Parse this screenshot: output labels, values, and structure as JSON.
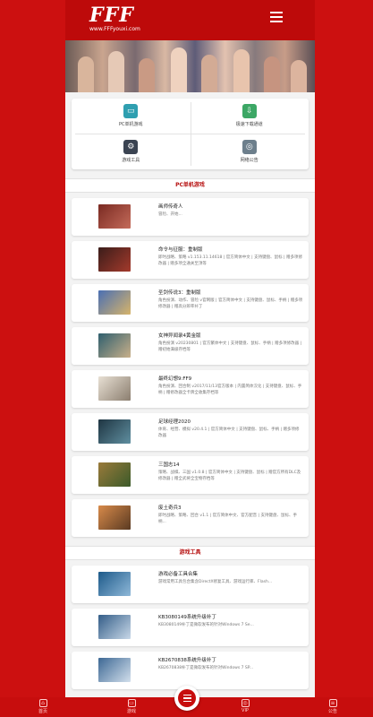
{
  "header": {
    "logo_mark": "FFF",
    "logo_sub": "www.FFFyouxi.com"
  },
  "quick_links": [
    {
      "label": "PC单机游戏",
      "icon": "monitor-icon",
      "color": "#2f9fb0"
    },
    {
      "label": "极速下载通道",
      "icon": "download-icon",
      "color": "#3ca765"
    },
    {
      "label": "游戏工具",
      "icon": "gear-icon",
      "color": "#3b4452"
    },
    {
      "label": "网络公告",
      "icon": "globe-icon",
      "color": "#6d7f8c"
    }
  ],
  "sections": {
    "pc_games": "PC单机游戏",
    "tools": "游戏工具"
  },
  "games": [
    {
      "title": "画师传奇人",
      "desc": "冒险、开始...",
      "thumb": "#7a2a22"
    },
    {
      "title": "命令与征服：重制版",
      "desc": "即时战略、策略 v1.153.11.14618 | 官方简体中文 | 支持键盘、鼠标 | 赠多项修改器 | 赠多项全通关至顶等",
      "thumb": "#3b1d1a"
    },
    {
      "title": "圣剑传说3：重制版",
      "desc": "角色扮演、动作、冒险 v官网版 | 官方简体中文 | 支持键盘、鼠标、手柄 | 赠多项修改器 | 赠高分辨率补丁",
      "thumb": "#4a6fb3"
    },
    {
      "title": "女神异闻录4黄金版",
      "desc": "角色扮演 v20230801 | 官方繁体中文 | 支持键盘、鼠标、手柄 | 赠多项修改器 | 赠初始满级存档等",
      "thumb": "#2f5f6e"
    },
    {
      "title": "最终幻想9:FF9",
      "desc": "角色扮演、回合制 v2017/11/13官方版本 | 内置简体汉化 | 支持键盘、鼠标、手柄 | 赠修改器全卡牌全收集存档等",
      "thumb": "#8b7e6f"
    },
    {
      "title": "足球经理2020",
      "desc": "体育、经营、模拟 v20.4.1 | 官方简体中文 | 支持键盘、鼠标、手柄 | 赠多项修改器",
      "thumb": "#1f3542"
    },
    {
      "title": "三国志14",
      "desc": "策略、战棋、三国 v1.0.8 | 官方简体中文 | 支持键盘、鼠标 | 赠官方所有DLC及修改器 | 赠全武将全宝物存档等",
      "thumb": "#9a7a3a"
    },
    {
      "title": "废土奇兵3",
      "desc": "即时战略、策略、回合 v1.1 | 官方简体中文、官方配音 | 支持键盘、鼠标、手柄...",
      "thumb": "#8d5a33"
    }
  ],
  "tools": [
    {
      "title": "游戏必备工具合集",
      "desc": "游戏常用工具包合集含DirectX修复工具、游戏运行库、Flash...",
      "thumb": "#1d5a8a"
    },
    {
      "title": "KB3080149系统升级补丁",
      "desc": "KB3080149补丁是微软发布的针对Windows 7 Se...",
      "thumb": "#335d88"
    },
    {
      "title": "KB2670838系统升级补丁",
      "desc": "KB2670838补丁是微软发布的针对Windows 7 SP...",
      "thumb": "#3d6894"
    }
  ],
  "tabbar": [
    {
      "label": "首页",
      "icon": "home-icon",
      "glyph": "⌂"
    },
    {
      "label": "游戏",
      "icon": "monitor-icon",
      "glyph": "▭"
    },
    {
      "label": "VIP",
      "icon": "globe-icon",
      "glyph": "◎"
    },
    {
      "label": "公告",
      "icon": "document-icon",
      "glyph": "≡"
    }
  ]
}
